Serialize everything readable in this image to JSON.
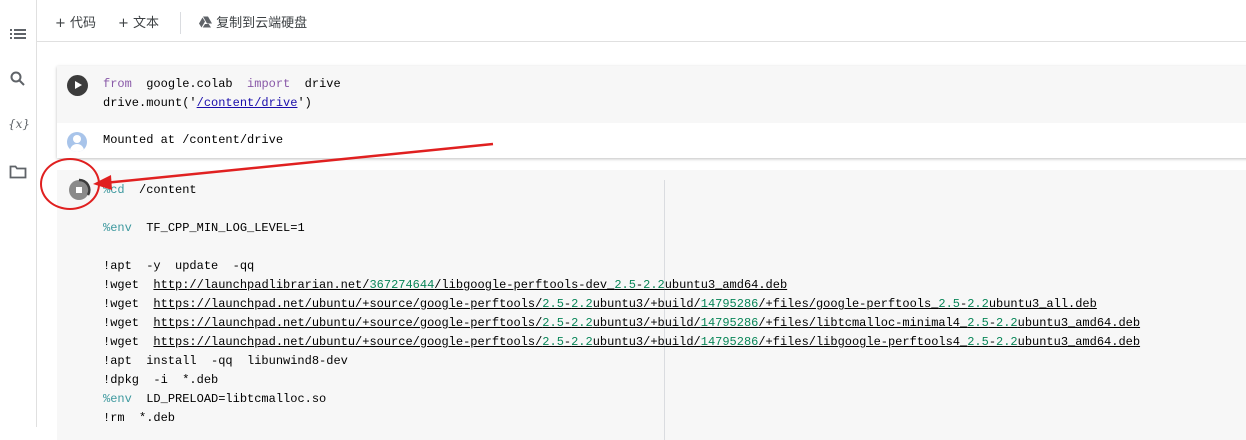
{
  "toolbar": {
    "add_code": "+ 代码",
    "add_text": "+ 文本",
    "copy_to_drive": "复制到云端硬盘"
  },
  "sidebar": {
    "items": [
      {
        "icon": "table-of-contents-icon"
      },
      {
        "icon": "search-icon"
      },
      {
        "icon": "variables-icon",
        "label": "{x}"
      },
      {
        "icon": "folder-icon"
      }
    ]
  },
  "cell1": {
    "line1": {
      "kw1": "from",
      "mod": "google.colab",
      "kw2": "import",
      "name": "drive"
    },
    "line2": {
      "pre": "drive.mount('",
      "path": "/content/drive",
      "post": "')"
    },
    "output": "Mounted at /content/drive"
  },
  "cell2": {
    "l1": {
      "magic": "%cd",
      "rest": "  /content"
    },
    "l2": {
      "magic": "%env",
      "rest": "  TF_CPP_MIN_LOG_LEVEL=1"
    },
    "l3": "!apt  -y  update  -qq",
    "l4": {
      "cmd": "!wget  ",
      "u1": "http://launchpadlibrarian.net/",
      "n1": "367274644",
      "u2": "/libgoogle-perftools-dev_",
      "n2": "2.5",
      "d": "-",
      "n3": "2.2",
      "u3": "ubuntu3_amd64.deb"
    },
    "l5": {
      "cmd": "!wget  ",
      "u1": "https://launchpad.net/ubuntu/+source/google-perftools/",
      "n1": "2.5",
      "d": "-",
      "n2": "2.2",
      "u2": "ubuntu3/+build/",
      "n3": "14795286",
      "u3": "/+files/google-perftools_",
      "n4": "2.5",
      "d2": "-",
      "n5": "2.2",
      "u4": "ubuntu3_all.deb"
    },
    "l6": {
      "cmd": "!wget  ",
      "u1": "https://launchpad.net/ubuntu/+source/google-perftools/",
      "n1": "2.5",
      "d": "-",
      "n2": "2.2",
      "u2": "ubuntu3/+build/",
      "n3": "14795286",
      "u3": "/+files/libtcmalloc-minimal4_",
      "n4": "2.5",
      "d2": "-",
      "n5": "2.2",
      "u4": "ubuntu3_amd64.deb"
    },
    "l7": {
      "cmd": "!wget  ",
      "u1": "https://launchpad.net/ubuntu/+source/google-perftools/",
      "n1": "2.5",
      "d": "-",
      "n2": "2.2",
      "u2": "ubuntu3/+build/",
      "n3": "14795286",
      "u3": "/+files/libgoogle-perftools4_",
      "n4": "2.5",
      "d2": "-",
      "n5": "2.2",
      "u4": "ubuntu3_amd64.deb"
    },
    "l8": "!apt  install  -qq  libunwind8-dev",
    "l9": "!dpkg  -i  *.deb",
    "l10": {
      "magic": "%env",
      "rest": "  LD_PRELOAD=libtcmalloc.so"
    },
    "l11": "!rm  *.deb"
  },
  "colors": {
    "keyword": "#8959a8",
    "magic": "#3e999f",
    "number": "#098658",
    "annotation": "#e02020"
  }
}
